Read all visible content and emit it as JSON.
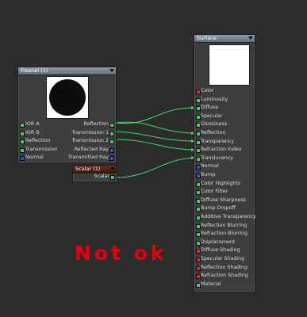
{
  "fresnel_node": {
    "title": "Fresnel (1)",
    "ports": [
      {
        "left": "IOR A",
        "left_color": "g",
        "right": "Reflection",
        "right_color": "g"
      },
      {
        "left": "IOR B",
        "left_color": "g",
        "right": "Transmission 1",
        "right_color": "g"
      },
      {
        "left": "Reflection",
        "left_color": "g",
        "right": "Transmission 2",
        "right_color": "g"
      },
      {
        "left": "Transmission",
        "left_color": "g",
        "right": "Reflected Ray",
        "right_color": "b"
      },
      {
        "left": "Normal",
        "left_color": "b",
        "right": "Transmitted Ray",
        "right_color": "b"
      }
    ]
  },
  "scalar_node": {
    "title": "Scalar (1)",
    "output": "Scalar"
  },
  "surface_node": {
    "title": "Surface",
    "inputs": [
      {
        "label": "Color",
        "color": "r"
      },
      {
        "label": "Luminosity",
        "color": "g"
      },
      {
        "label": "Diffuse",
        "color": "g"
      },
      {
        "label": "Specular",
        "color": "g"
      },
      {
        "label": "Glossiness",
        "color": "g"
      },
      {
        "label": "Reflection",
        "color": "g"
      },
      {
        "label": "Transparency",
        "color": "g"
      },
      {
        "label": "Refraction Index",
        "color": "g"
      },
      {
        "label": "Translucency",
        "color": "g"
      },
      {
        "label": "Normal",
        "color": "b"
      },
      {
        "label": "Bump",
        "color": "b"
      },
      {
        "label": "Color Highlights",
        "color": "g"
      },
      {
        "label": "Color Filter",
        "color": "g"
      },
      {
        "label": "Diffuse Sharpness",
        "color": "g"
      },
      {
        "label": "Bump Dropoff",
        "color": "g"
      },
      {
        "label": "Additive Transparency",
        "color": "g"
      },
      {
        "label": "Reflection Blurring",
        "color": "g"
      },
      {
        "label": "Refraction Blurring",
        "color": "g"
      },
      {
        "label": "Displacement",
        "color": "g"
      },
      {
        "label": "Diffuse Shading",
        "color": "r"
      },
      {
        "label": "Specular Shading",
        "color": "r"
      },
      {
        "label": "Reflection Shading",
        "color": "r"
      },
      {
        "label": "Refraction Shading",
        "color": "r"
      },
      {
        "label": "Material",
        "color": "t"
      }
    ]
  },
  "annotation": "Not ok",
  "colors": {
    "port_green": "#43c96a",
    "port_red": "#c83232",
    "port_blue": "#3a4fd0",
    "port_teal": "#3fbfbf",
    "wire": "#3fdc6a",
    "annotation_red": "#e6000e"
  }
}
